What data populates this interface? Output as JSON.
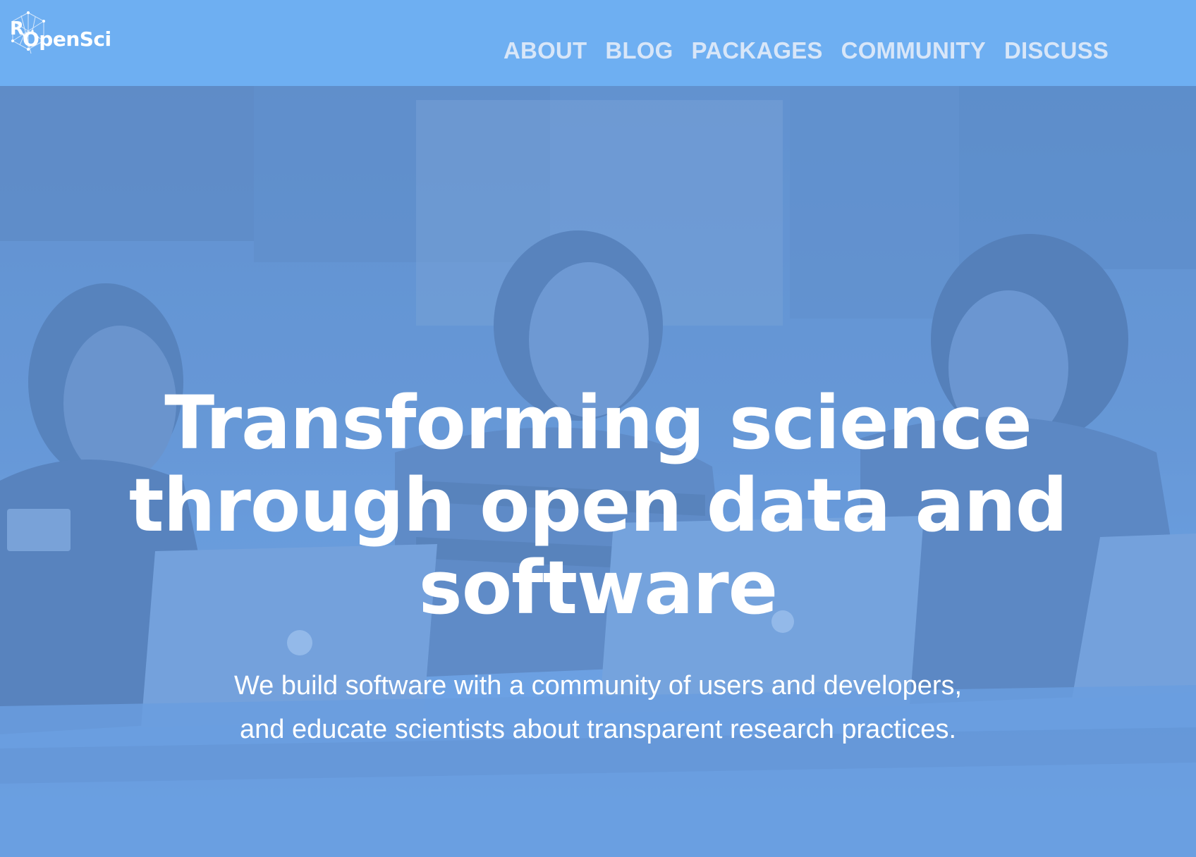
{
  "brand": {
    "logo_r": "R",
    "logo_text": "OpenSci"
  },
  "nav": {
    "items": [
      {
        "label": "ABOUT"
      },
      {
        "label": "BLOG"
      },
      {
        "label": "PACKAGES"
      },
      {
        "label": "COMMUNITY"
      },
      {
        "label": "DISCUSS"
      }
    ]
  },
  "hero": {
    "headline": "Transforming science through open data and software",
    "subtext_line1": "We build software with a community of users and developers,",
    "subtext_line2": "and educate scientists about transparent research practices."
  },
  "colors": {
    "header_bg": "#6eaff2",
    "hero_tint": "#6a9ee0",
    "nav_text": "#d8e6f8",
    "text": "#ffffff"
  },
  "icons": {
    "logo_mark": "hexagon-network-icon"
  }
}
